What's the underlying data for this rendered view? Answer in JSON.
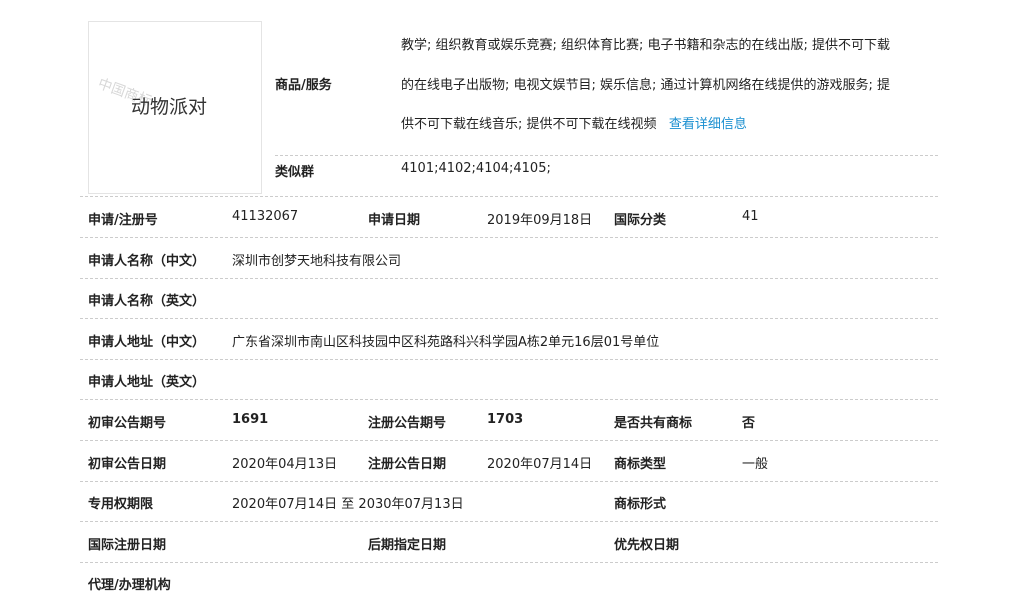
{
  "trademark": {
    "name": "动物派对",
    "watermark": "中国商标"
  },
  "goods": {
    "label": "商品/服务",
    "lines": [
      "教学; 组织教育或娱乐竞赛; 组织体育比赛; 电子书籍和杂志的在线出版; 提供不可下载",
      "的在线电子出版物; 电视文娱节目; 娱乐信息; 通过计算机网络在线提供的游戏服务; 提",
      "供不可下载在线音乐; 提供不可下载在线视频"
    ],
    "detail_link": "查看详细信息"
  },
  "similar": {
    "label": "类似群",
    "value": "4101;4102;4104;4105;"
  },
  "rows": [
    [
      {
        "l": "申请/注册号",
        "v": "41132067"
      },
      {
        "l": "申请日期",
        "v": "2019年09月18日"
      },
      {
        "l": "国际分类",
        "v": "41"
      }
    ],
    [
      {
        "l": "申请人名称（中文）",
        "v": "深圳市创梦天地科技有限公司"
      }
    ],
    [
      {
        "l": "申请人名称（英文）",
        "v": ""
      }
    ],
    [
      {
        "l": "申请人地址（中文）",
        "v": "广东省深圳市南山区科技园中区科苑路科兴科学园A栋2单元16层01号单位"
      }
    ],
    [
      {
        "l": "申请人地址（英文）",
        "v": ""
      }
    ],
    [
      {
        "l": "初审公告期号",
        "v": "1691"
      },
      {
        "l": "注册公告期号",
        "v": "1703"
      },
      {
        "l": "是否共有商标",
        "v": "否"
      }
    ],
    [
      {
        "l": "初审公告日期",
        "v": "2020年04月13日"
      },
      {
        "l": "注册公告日期",
        "v": "2020年07月14日"
      },
      {
        "l": "商标类型",
        "v": "一般"
      }
    ],
    [
      {
        "l": "专用权期限",
        "v": "2020年07月14日 至 2030年07月13日"
      },
      {
        "l": "",
        "v": ""
      },
      {
        "l": "商标形式",
        "v": ""
      }
    ],
    [
      {
        "l": "国际注册日期",
        "v": ""
      },
      {
        "l": "后期指定日期",
        "v": ""
      },
      {
        "l": "优先权日期",
        "v": ""
      }
    ],
    [
      {
        "l": "代理/办理机构",
        "v": ""
      }
    ]
  ]
}
